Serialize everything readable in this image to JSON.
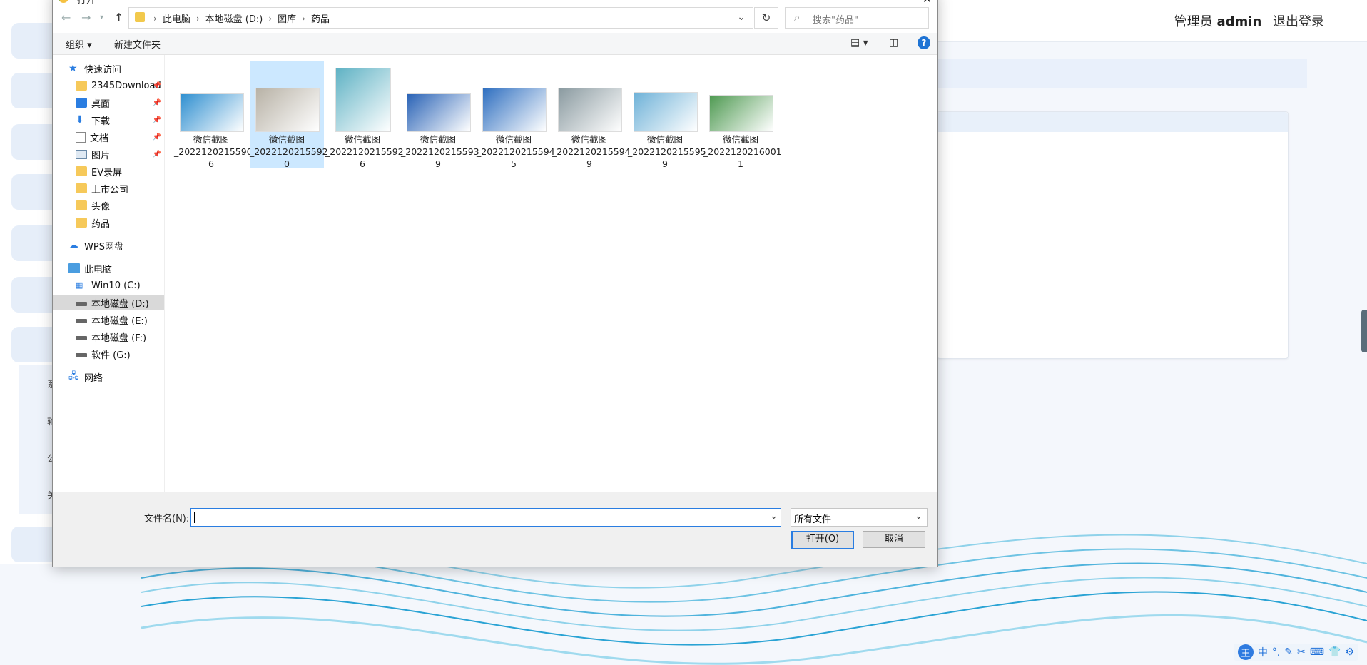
{
  "background": {
    "user_role": "管理员",
    "user_name": "admin",
    "logout": "退出登录",
    "side_labels": [
      "系",
      "轮",
      "公",
      "关"
    ]
  },
  "dialog": {
    "title": "打开",
    "address": {
      "crumbs": [
        "此电脑",
        "本地磁盘 (D:)",
        "图库",
        "药品"
      ]
    },
    "search_placeholder": "搜索\"药品\"",
    "toolbar": {
      "organize": "组织 ▾",
      "new_folder": "新建文件夹"
    },
    "nav": {
      "quick_access": "快速访问",
      "items": [
        {
          "label": "2345Download",
          "icon": "folder-icon",
          "pinned": true
        },
        {
          "label": "桌面",
          "icon": "desktop-icon",
          "pinned": true
        },
        {
          "label": "下载",
          "icon": "download-icon",
          "pinned": true
        },
        {
          "label": "文档",
          "icon": "document-icon",
          "pinned": true
        },
        {
          "label": "图片",
          "icon": "pictures-icon",
          "pinned": true
        },
        {
          "label": "EV录屏",
          "icon": "folder-icon",
          "pinned": false
        },
        {
          "label": "上市公司",
          "icon": "folder-icon",
          "pinned": false
        },
        {
          "label": "头像",
          "icon": "folder-icon",
          "pinned": false
        },
        {
          "label": "药品",
          "icon": "folder-icon",
          "pinned": false
        }
      ],
      "wps": "WPS网盘",
      "this_pc": "此电脑",
      "drives": [
        {
          "label": "Win10 (C:)",
          "selected": false
        },
        {
          "label": "本地磁盘 (D:)",
          "selected": true
        },
        {
          "label": "本地磁盘 (E:)",
          "selected": false
        },
        {
          "label": "本地磁盘 (F:)",
          "selected": false
        },
        {
          "label": "软件 (G:)",
          "selected": false
        }
      ],
      "network": "网络"
    },
    "files": [
      {
        "line1": "微信截图",
        "line2": "_2022120215590",
        "line3": "6",
        "color": "#2f8fd0",
        "selected": false
      },
      {
        "line1": "微信截图",
        "line2": "_2022120215592",
        "line3": "0",
        "color": "#b8b2a6",
        "selected": true
      },
      {
        "line1": "微信截图",
        "line2": "_2022120215592",
        "line3": "6",
        "color": "#5fb2c4",
        "selected": false
      },
      {
        "line1": "微信截图",
        "line2": "_2022120215593",
        "line3": "9",
        "color": "#2a63b6",
        "selected": false
      },
      {
        "line1": "微信截图",
        "line2": "_2022120215594",
        "line3": "5",
        "color": "#2f6fc0",
        "selected": false
      },
      {
        "line1": "微信截图",
        "line2": "_2022120215594",
        "line3": "9",
        "color": "#8a9aa0",
        "selected": false
      },
      {
        "line1": "微信截图",
        "line2": "_2022120215595",
        "line3": "9",
        "color": "#6fb2d8",
        "selected": false
      },
      {
        "line1": "微信截图",
        "line2": "_2022120216001",
        "line3": "1",
        "color": "#4f9a52",
        "selected": false
      }
    ],
    "filename_label": "文件名(N):",
    "filename_value": "",
    "file_type": "所有文件",
    "open_button": "打开(O)",
    "cancel_button": "取消"
  },
  "ime": {
    "items": [
      "王",
      "中",
      "°,",
      "✎",
      "✂",
      "⌨",
      "👕",
      "⚙"
    ]
  }
}
